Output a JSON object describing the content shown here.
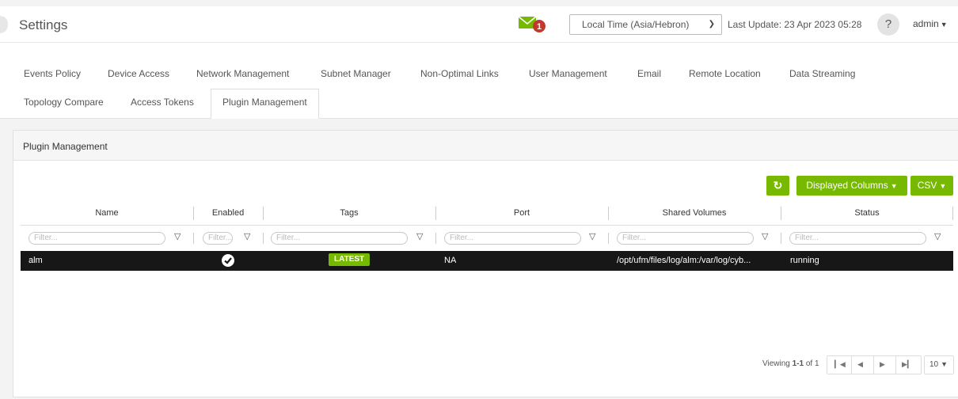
{
  "header": {
    "title": "Settings",
    "mail_count": "1",
    "timezone": "Local Time (Asia/Hebron)",
    "last_update": "Last Update: 23 Apr 2023 05:28",
    "help": "?",
    "user": "admin"
  },
  "tabs": [
    {
      "label": "Events Policy"
    },
    {
      "label": "Device Access"
    },
    {
      "label": "Network Management"
    },
    {
      "label": "Subnet Manager"
    },
    {
      "label": "Non-Optimal Links"
    },
    {
      "label": "User Management"
    },
    {
      "label": "Email"
    },
    {
      "label": "Remote Location"
    },
    {
      "label": "Data Streaming"
    },
    {
      "label": "Topology Compare"
    },
    {
      "label": "Access Tokens"
    },
    {
      "label": "Plugin Management",
      "active": true
    }
  ],
  "panel": {
    "title": "Plugin Management",
    "displayed_columns": "Displayed Columns",
    "csv": "CSV"
  },
  "table": {
    "columns": [
      "Name",
      "Enabled",
      "Tags",
      "Port",
      "Shared Volumes",
      "Status"
    ],
    "filter_placeholder": "Filter...",
    "rows": [
      {
        "name": "alm",
        "enabled": true,
        "tag": "LATEST",
        "port": "NA",
        "shared_volumes": "/opt/ufm/files/log/alm:/var/log/cyb...",
        "status": "running"
      }
    ]
  },
  "pagination": {
    "viewing_prefix": "Viewing",
    "range": "1-1",
    "of": "of 1",
    "page_size": "10"
  },
  "colors": {
    "accent": "#76b900",
    "mail_badge": "#c0392b",
    "selected_row": "#171717"
  }
}
